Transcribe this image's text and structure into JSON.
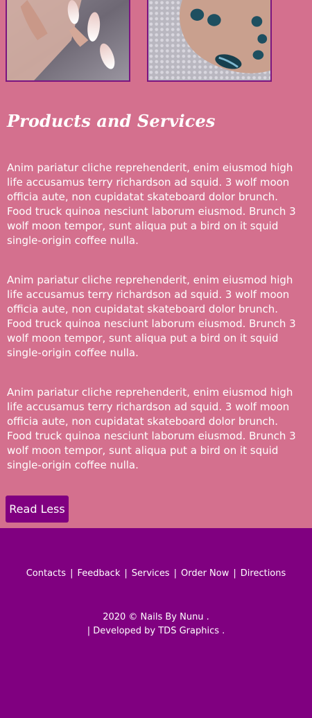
{
  "gallery": {
    "images": [
      {
        "icon": "manicure-nails-photo",
        "alt": ""
      },
      {
        "icon": "pedicure-toes-photo",
        "alt": ""
      }
    ]
  },
  "services": {
    "title": "Products and Services",
    "paragraphs": [
      "Anim pariatur cliche reprehenderit, enim eiusmod high life accusamus terry richardson ad squid. 3 wolf moon officia aute, non cupidatat skateboard dolor brunch. Food truck quinoa nesciunt laborum eiusmod. Brunch 3 wolf moon tempor, sunt aliqua put a bird on it squid single-origin coffee nulla.",
      "Anim pariatur cliche reprehenderit, enim eiusmod high life accusamus terry richardson ad squid. 3 wolf moon officia aute, non cupidatat skateboard dolor brunch. Food truck quinoa nesciunt laborum eiusmod. Brunch 3 wolf moon tempor, sunt aliqua put a bird on it squid single-origin coffee nulla.",
      "Anim pariatur cliche reprehenderit, enim eiusmod high life accusamus terry richardson ad squid. 3 wolf moon officia aute, non cupidatat skateboard dolor brunch. Food truck quinoa nesciunt laborum eiusmod. Brunch 3 wolf moon tempor, sunt aliqua put a bird on it squid single-origin coffee nulla."
    ],
    "read_less_label": "Read Less"
  },
  "footer": {
    "links": [
      "Contacts",
      "Feedback",
      "Services",
      "Order Now",
      "Directions"
    ],
    "separator": "|",
    "copyright_line1": "2020 ©  Nails By Nunu .",
    "copyright_line2": "| Developed by  TDS Graphics ."
  },
  "colors": {
    "page_background": "#d4708e",
    "footer_background": "#800080",
    "button_background": "#800080",
    "text": "#ffffff"
  }
}
